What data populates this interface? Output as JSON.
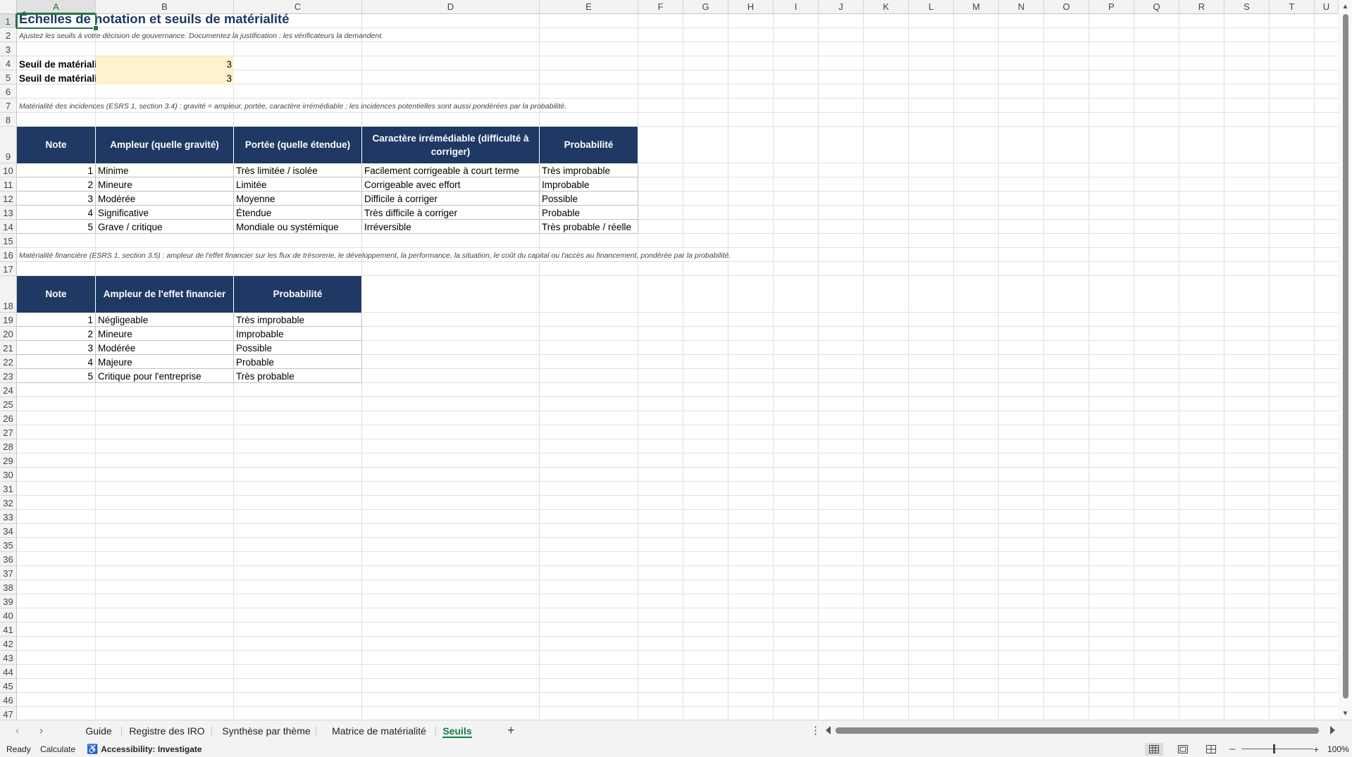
{
  "columns": [
    "A",
    "B",
    "C",
    "D",
    "E",
    "F",
    "G",
    "H",
    "I",
    "J",
    "K",
    "L",
    "M",
    "N",
    "O",
    "P",
    "Q",
    "R",
    "S",
    "T",
    "U"
  ],
  "rows": [
    "1",
    "2",
    "3",
    "4",
    "5",
    "6",
    "7",
    "8",
    "9",
    "10",
    "11",
    "12",
    "13",
    "14",
    "15",
    "16",
    "17",
    "18",
    "19",
    "20",
    "21",
    "22",
    "23",
    "24",
    "25",
    "26",
    "27",
    "28",
    "29",
    "30",
    "31",
    "32",
    "33",
    "34",
    "35",
    "36",
    "37",
    "38",
    "39",
    "40",
    "41",
    "42",
    "43",
    "44",
    "45",
    "46",
    "47"
  ],
  "active_cell": "A1",
  "sheet": {
    "title": "Échelles de notation et seuils de matérialité",
    "subtitle": "Ajustez les seuils à votre décision de gouvernance. Documentez la justification : les vérificateurs la demandent.",
    "threshold_rows": [
      {
        "label": "Seuil de matériali",
        "value": "3"
      },
      {
        "label": "Seuil de matériali",
        "value": "3"
      }
    ],
    "impact_note": "Matérialité des incidences (ESRS 1, section 3.4) : gravité = ampleur, portée, caractère irrémédiable ; les incidences potentielles sont aussi pondérées par la probabilité.",
    "impact_headers": [
      "Note",
      "Ampleur (quelle gravité)",
      "Portée (quelle étendue)",
      "Caractère irrémédiable (difficulté à corriger)",
      "Probabilité"
    ],
    "impact_rows": [
      [
        "1",
        "Minime",
        "Très limitée / isolée",
        "Facilement corrigeable à court terme",
        "Très improbable"
      ],
      [
        "2",
        "Mineure",
        "Limitée",
        "Corrigeable avec effort",
        "Improbable"
      ],
      [
        "3",
        "Modérée",
        "Moyenne",
        "Difficile à corriger",
        "Possible"
      ],
      [
        "4",
        "Significative",
        "Étendue",
        "Très difficile à corriger",
        "Probable"
      ],
      [
        "5",
        "Grave / critique",
        "Mondiale ou systémique",
        "Irréversible",
        "Très probable / réelle"
      ]
    ],
    "financial_note": "Matérialité financière (ESRS 1, section 3.5) : ampleur de l'effet financier sur les flux de trésorerie, le développement, la performance, la situation, le coût du capital ou l'accès au financement, pondérée par la probabilité.",
    "financial_headers": [
      "Note",
      "Ampleur de l'effet financier",
      "Probabilité"
    ],
    "financial_rows": [
      [
        "1",
        "Négligeable",
        "Très improbable"
      ],
      [
        "2",
        "Mineure",
        "Improbable"
      ],
      [
        "3",
        "Modérée",
        "Possible"
      ],
      [
        "4",
        "Majeure",
        "Probable"
      ],
      [
        "5",
        "Critique pour l'entreprise",
        "Très probable"
      ]
    ]
  },
  "tabs": [
    {
      "label": "Guide",
      "active": false
    },
    {
      "label": "Registre des IRO",
      "active": false
    },
    {
      "label": "Synthèse par thème",
      "active": false
    },
    {
      "label": "Matrice de matérialité",
      "active": false
    },
    {
      "label": "Seuils",
      "active": true
    }
  ],
  "statusbar": {
    "ready": "Ready",
    "calculate": "Calculate",
    "accessibility": "Accessibility: Investigate",
    "zoom": "100%"
  },
  "colors": {
    "header_fill": "#1f3864",
    "input_fill": "#fff2cc",
    "title_color": "#1f3864",
    "accent": "#217346"
  },
  "icons": {
    "tab_prev": "chevron-left-icon",
    "tab_next": "chevron-right-icon",
    "add_sheet": "plus-icon",
    "more": "vertical-ellipsis-icon",
    "accessibility": "accessibility-icon",
    "normal_view": "normal-view-icon",
    "page_layout": "page-layout-icon",
    "page_break": "page-break-preview-icon"
  }
}
